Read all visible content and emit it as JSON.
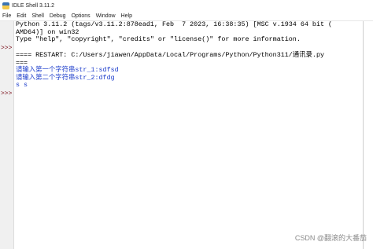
{
  "window": {
    "title": "IDLE Shell 3.11.2"
  },
  "menu": [
    "File",
    "Edit",
    "Shell",
    "Debug",
    "Options",
    "Window",
    "Help"
  ],
  "gutter": {
    "prompt1": ">>>",
    "prompt2": ">>>"
  },
  "shell": {
    "banner1": "Python 3.11.2 (tags/v3.11.2:878ead1, Feb  7 2023, 16:38:35) [MSC v.1934 64 bit (",
    "banner2": "AMD64)] on win32",
    "banner3": "Type \"help\", \"copyright\", \"credits\" or \"license()\" for more information.",
    "restart1": "==== RESTART: C:/Users/jiawen/AppData/Local/Programs/Python/Python311/通讯录.py",
    "restart2": "===",
    "input1": "请输入第一个字符串str_1:sdfsd",
    "input2": "请输入第二个字符串str_2:dfdg",
    "output": "s s"
  },
  "watermark": "CSDN @翻滚的大番茄"
}
